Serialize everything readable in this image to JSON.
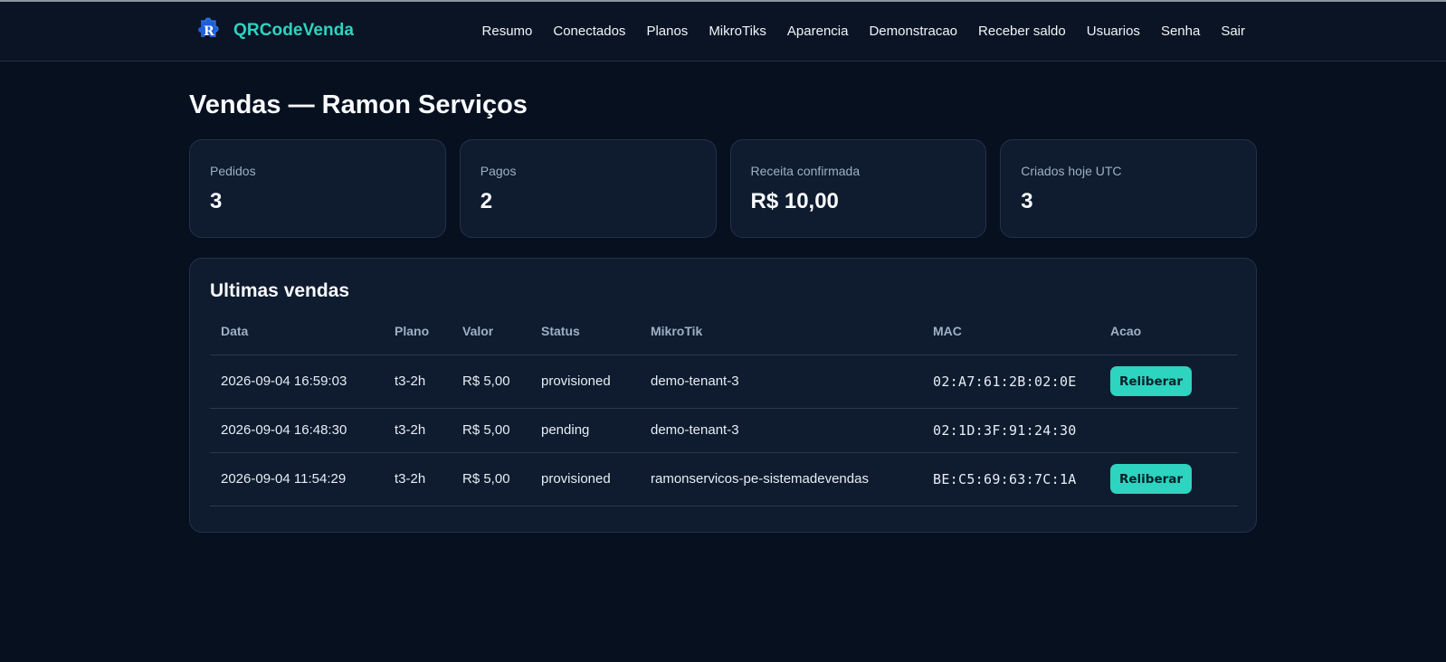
{
  "brand": {
    "name": "QRCodeVenda",
    "logo_icon": "puzzle-r-logo",
    "accent": "#2dd4bf"
  },
  "nav": [
    "Resumo",
    "Conectados",
    "Planos",
    "MikroTiks",
    "Aparencia",
    "Demonstracao",
    "Receber saldo",
    "Usuarios",
    "Senha",
    "Sair"
  ],
  "page_title": "Vendas — Ramon Serviços",
  "stats": [
    {
      "label": "Pedidos",
      "value": "3"
    },
    {
      "label": "Pagos",
      "value": "2"
    },
    {
      "label": "Receita confirmada",
      "value": "R$ 10,00"
    },
    {
      "label": "Criados hoje UTC",
      "value": "3"
    }
  ],
  "sales": {
    "title": "Ultimas vendas",
    "columns": [
      "Data",
      "Plano",
      "Valor",
      "Status",
      "MikroTik",
      "MAC",
      "Acao"
    ],
    "rows": [
      {
        "data": "2026-09-04 16:59:03",
        "plano": "t3-2h",
        "valor": "R$ 5,00",
        "status": "provisioned",
        "mikrotik": "demo-tenant-3",
        "mac": "02:A7:61:2B:02:0E",
        "acao": "Reliberar"
      },
      {
        "data": "2026-09-04 16:48:30",
        "plano": "t3-2h",
        "valor": "R$ 5,00",
        "status": "pending",
        "mikrotik": "demo-tenant-3",
        "mac": "02:1D:3F:91:24:30",
        "acao": ""
      },
      {
        "data": "2026-09-04 11:54:29",
        "plano": "t3-2h",
        "valor": "R$ 5,00",
        "status": "provisioned",
        "mikrotik": "ramonservicos-pe-sistemadevendas",
        "mac": "BE:C5:69:63:7C:1A",
        "acao": "Reliberar"
      }
    ]
  }
}
